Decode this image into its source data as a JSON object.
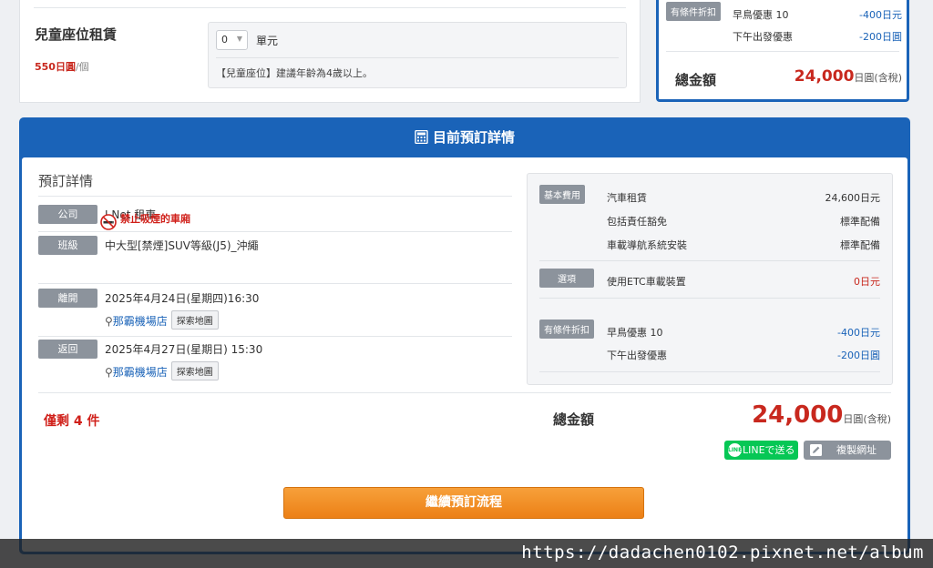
{
  "child_seat": {
    "title": "兒童座位租賃",
    "price": "550日圓",
    "per": "/個",
    "qty": "0",
    "unit": "單元",
    "note": "【兒童座位】建議年齡為4歲以上。"
  },
  "summary_top": {
    "badge": "有條件折扣",
    "discounts": [
      {
        "label": "早鳥優惠 10",
        "value": "-400日元"
      },
      {
        "label": "下午出發優惠",
        "value": "-200日圓"
      }
    ],
    "total_label": "總金額",
    "total_value": "24,000",
    "total_suffix": "日圓(含稅)"
  },
  "panel": {
    "title": "目前預訂詳情",
    "details_title": "預訂詳情",
    "company_label": "公司",
    "company_value": "J Net 租車",
    "class_label": "班級",
    "class_value": "中大型[禁煙]SUV等級(J5)_沖繩",
    "no_smoking": "禁止吸煙的車廂",
    "depart_label": "離開",
    "depart_value": "2025年4月24日(星期四)16:30",
    "depart_shop": "那霸機場店",
    "return_label": "返回",
    "return_value": "2025年4月27日(星期日) 15:30",
    "return_shop": "那霸機場店",
    "map_button": "探索地圖"
  },
  "fees": {
    "basic_badge": "基本費用",
    "basic": [
      {
        "label": "汽車租賃",
        "value": "24,600日元"
      },
      {
        "label": "包括責任豁免",
        "value": "標準配備"
      },
      {
        "label": "車載導航系統安裝",
        "value": "標準配備"
      }
    ],
    "option_badge": "選項",
    "options": [
      {
        "label": "使用ETC車載裝置",
        "value": "0日元"
      }
    ],
    "discount_badge": "有條件折扣",
    "discounts": [
      {
        "label": "早鳥優惠 10",
        "value": "-400日元"
      },
      {
        "label": "下午出發優惠",
        "value": "-200日圓"
      }
    ]
  },
  "footer": {
    "remaining": "僅剩 4 件",
    "total_label": "總金額",
    "total_value": "24,000",
    "total_suffix": "日圓(含稅)",
    "line_button": "LINEで送る",
    "line_icon_text": "LINE",
    "copy_button": "複製網址",
    "continue_button": "繼續預訂流程"
  },
  "watermark": "https://dadachen0102.pixnet.net/album",
  "colors": {
    "brand_blue": "#1a63b8",
    "price_red": "#c8281e",
    "cta_orange": "#f08a1f",
    "line_green": "#06c755",
    "badge_gray": "#8c939c"
  }
}
